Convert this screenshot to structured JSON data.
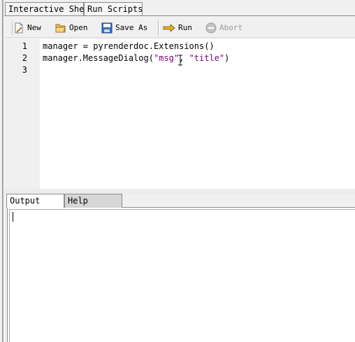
{
  "tabs": {
    "interactive_shell": "Interactive Shell",
    "run_scripts": "Run Scripts"
  },
  "toolbar": {
    "new_label": "New",
    "open_label": "Open",
    "save_as_label": "Save As",
    "run_label": "Run",
    "abort_label": "Abort"
  },
  "editor": {
    "line_numbers": [
      "1",
      "2",
      "3"
    ],
    "lines": {
      "l1": "manager = pyrenderdoc.Extensions()",
      "l2_pre": "manager.MessageDialog(",
      "l2_str1": "\"msg\"",
      "l2_mid": ", ",
      "l2_str2": "\"title\"",
      "l2_post": ")",
      "l3": ""
    }
  },
  "bottom_tabs": {
    "output": "Output",
    "help": "Help"
  },
  "output": {
    "text": ""
  },
  "colors": {
    "string": "#7f007f",
    "background": "#f0f0f0",
    "editor_bg": "#ffffff"
  }
}
